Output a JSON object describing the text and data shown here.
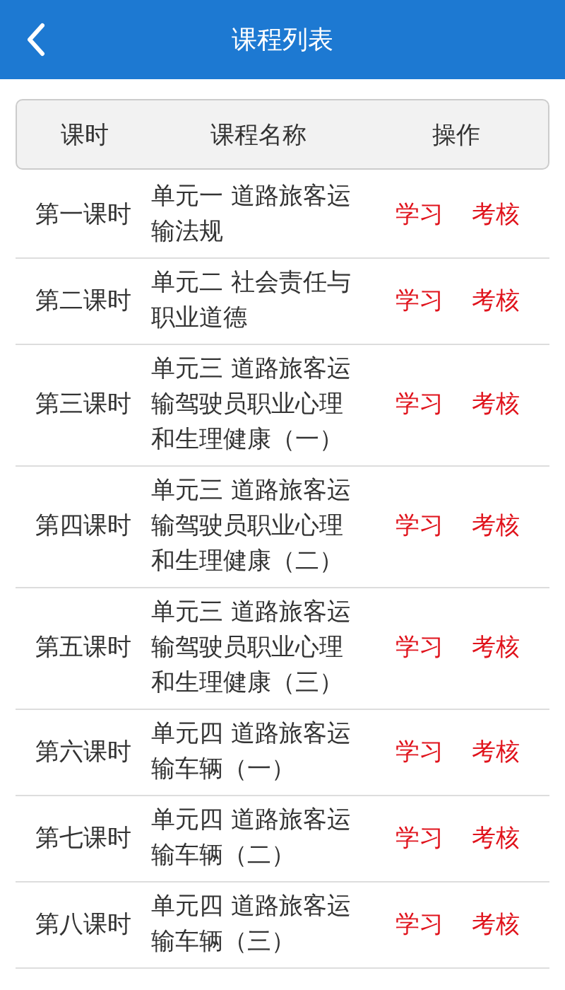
{
  "header": {
    "title": "课程列表"
  },
  "table": {
    "columns": [
      "课时",
      "课程名称",
      "操作"
    ],
    "rows": [
      {
        "lesson": "第一课时",
        "name": "单元一 道路旅客运输法规",
        "actions": [
          "学习",
          "考核"
        ]
      },
      {
        "lesson": "第二课时",
        "name": "单元二 社会责任与职业道德",
        "actions": [
          "学习",
          "考核"
        ]
      },
      {
        "lesson": "第三课时",
        "name": "单元三 道路旅客运输驾驶员职业心理和生理健康（一）",
        "actions": [
          "学习",
          "考核"
        ]
      },
      {
        "lesson": "第四课时",
        "name": "单元三 道路旅客运输驾驶员职业心理和生理健康（二）",
        "actions": [
          "学习",
          "考核"
        ]
      },
      {
        "lesson": "第五课时",
        "name": "单元三 道路旅客运输驾驶员职业心理和生理健康（三）",
        "actions": [
          "学习",
          "考核"
        ]
      },
      {
        "lesson": "第六课时",
        "name": "单元四 道路旅客运输车辆（一）",
        "actions": [
          "学习",
          "考核"
        ]
      },
      {
        "lesson": "第七课时",
        "name": "单元四 道路旅客运输车辆（二）",
        "actions": [
          "学习",
          "考核"
        ]
      },
      {
        "lesson": "第八课时",
        "name": "单元四 道路旅客运输车辆（三）",
        "actions": [
          "学习",
          "考核"
        ]
      }
    ]
  }
}
